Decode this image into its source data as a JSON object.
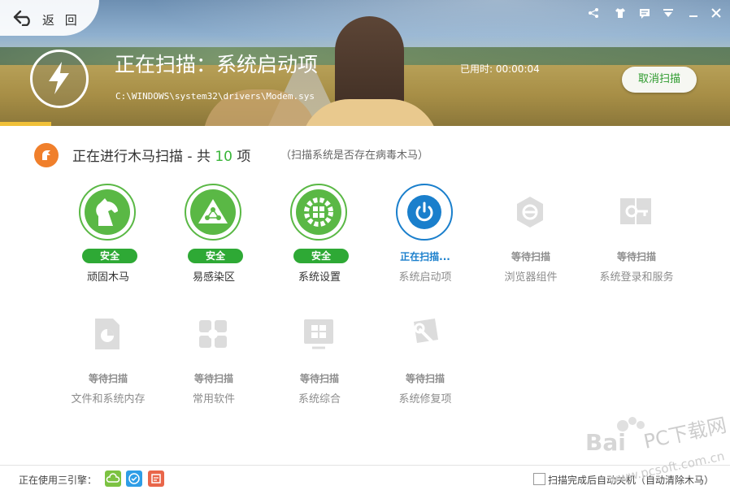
{
  "header": {
    "back_label": "返 回",
    "scan_title": "正在扫描：系统启动项",
    "scan_path": "C:\\WINDOWS\\system32\\drivers\\Modem.sys",
    "elapsed": "已用时: 00:00:04",
    "cancel_label": "取消扫描",
    "progress": 0.07
  },
  "section": {
    "title_prefix": "正在进行木马扫描 - 共 ",
    "count": "10",
    "title_suffix": " 项",
    "subtitle": "（扫描系统是否存在病毒木马）"
  },
  "items": [
    {
      "label": "顽固木马",
      "status": "安全",
      "state": "done",
      "icon": "horse-icon"
    },
    {
      "label": "易感染区",
      "status": "安全",
      "state": "done",
      "icon": "hazard-icon"
    },
    {
      "label": "系统设置",
      "status": "安全",
      "state": "done",
      "icon": "windows-gear-icon"
    },
    {
      "label": "系统启动项",
      "status": "正在扫描...",
      "state": "active",
      "icon": "power-icon"
    },
    {
      "label": "浏览器组件",
      "status": "等待扫描",
      "state": "wait",
      "icon": "browser-icon"
    },
    {
      "label": "系统登录和服务",
      "status": "等待扫描",
      "state": "wait",
      "icon": "service-icon"
    },
    {
      "label": "文件和系统内存",
      "status": "等待扫描",
      "state": "wait",
      "icon": "memory-icon"
    },
    {
      "label": "常用软件",
      "status": "等待扫描",
      "state": "wait",
      "icon": "software-icon"
    },
    {
      "label": "系统综合",
      "status": "等待扫描",
      "state": "wait",
      "icon": "system-icon"
    },
    {
      "label": "系统修复项",
      "status": "等待扫描",
      "state": "wait",
      "icon": "repair-icon"
    }
  ],
  "footer": {
    "engines_label": "正在使用三引擎：",
    "auto_shutdown_label": "扫描完成后自动关机（自动清除木马）"
  },
  "watermark": {
    "text1": "Bai",
    "text2": "PC下载网",
    "text3": "www.pcsoft.com.cn"
  },
  "colors": {
    "safe": "#2ea935",
    "active": "#1a7fcc",
    "wait": "#8c8c8c",
    "accent": "#f07f2b"
  }
}
